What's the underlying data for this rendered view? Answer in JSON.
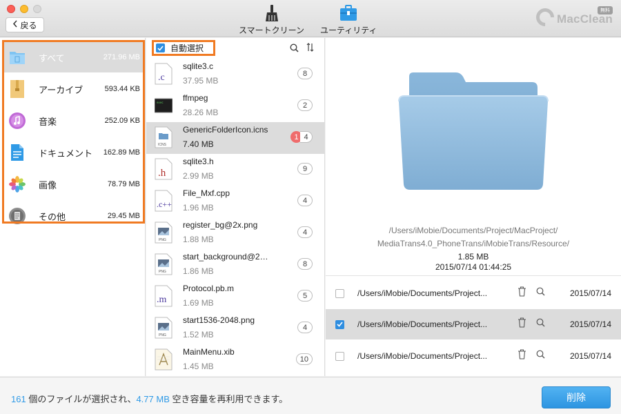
{
  "window": {
    "back_label": "戻る",
    "toolbar": [
      {
        "label": "スマートクリーン",
        "icon": "broom-icon"
      },
      {
        "label": "ユーティリティ",
        "icon": "toolbox-icon"
      }
    ],
    "brand_name": "MacClean",
    "brand_badge": "無料"
  },
  "sidebar": {
    "items": [
      {
        "label": "すべて",
        "size": "271.96 MB",
        "icon": "all-files-icon",
        "selected": true
      },
      {
        "label": "アーカイブ",
        "size": "593.44 KB",
        "icon": "archive-icon"
      },
      {
        "label": "音楽",
        "size": "252.09 KB",
        "icon": "music-icon"
      },
      {
        "label": "ドキュメント",
        "size": "162.89 MB",
        "icon": "document-icon"
      },
      {
        "label": "画像",
        "size": "78.79 MB",
        "icon": "photos-icon"
      },
      {
        "label": "その他",
        "size": "29.45 MB",
        "icon": "other-icon"
      }
    ]
  },
  "file_list": {
    "auto_select_label": "自動選択",
    "auto_select_checked": true,
    "files": [
      {
        "name": "sqlite3.c",
        "size": "37.95 MB",
        "count": "8",
        "type": "c"
      },
      {
        "name": "ffmpeg",
        "size": "28.26 MB",
        "count": "2",
        "type": "exec"
      },
      {
        "name": "GenericFolderIcon.icns",
        "size": "7.40 MB",
        "count": "4",
        "selected_count": "1",
        "type": "icns",
        "selected": true
      },
      {
        "name": "sqlite3.h",
        "size": "2.99 MB",
        "count": "9",
        "type": "h"
      },
      {
        "name": "File_Mxf.cpp",
        "size": "1.96 MB",
        "count": "4",
        "type": "cpp"
      },
      {
        "name": "register_bg@2x.png",
        "size": "1.88 MB",
        "count": "4",
        "type": "png"
      },
      {
        "name": "start_background@2…",
        "size": "1.86 MB",
        "count": "8",
        "type": "png"
      },
      {
        "name": "Protocol.pb.m",
        "size": "1.69 MB",
        "count": "5",
        "type": "m"
      },
      {
        "name": "start1536-2048.png",
        "size": "1.52 MB",
        "count": "4",
        "type": "png"
      },
      {
        "name": "MainMenu.xib",
        "size": "1.45 MB",
        "count": "10",
        "type": "xib"
      }
    ]
  },
  "preview": {
    "path_line1": "/Users/iMobie/Documents/Project/MacProject/",
    "path_line2": "MediaTrans4.0_PhoneTrans/iMobieTrans/Resource/",
    "size": "1.85 MB",
    "date": "2015/07/14 01:44:25",
    "duplicates": [
      {
        "path": "/Users/iMobie/Documents/Project...",
        "date": "2015/07/14",
        "checked": false
      },
      {
        "path": "/Users/iMobie/Documents/Project...",
        "date": "2015/07/14",
        "checked": true
      },
      {
        "path": "/Users/iMobie/Documents/Project...",
        "date": "2015/07/14",
        "checked": false
      }
    ]
  },
  "footer": {
    "file_count": "161",
    "text_part1": " 個のファイルが選択され、",
    "freed_size": "4.77 MB",
    "text_part2": " 空き容量を再利用できます。",
    "delete_label": "削除"
  },
  "colors": {
    "accent_blue": "#2f9ae6",
    "highlight_orange": "#f07a22",
    "selected_row": "#dcdcdc",
    "badge_red": "#ef6c6c"
  }
}
